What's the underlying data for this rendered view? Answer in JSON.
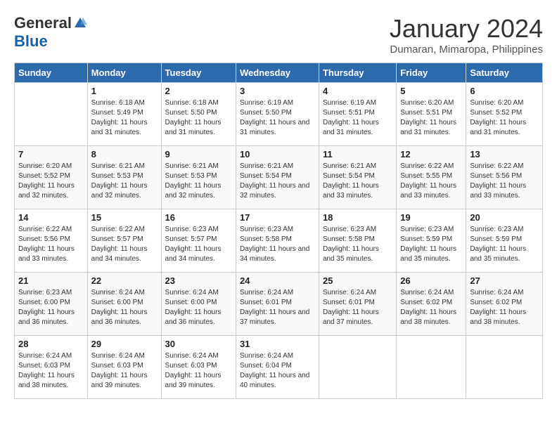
{
  "header": {
    "logo_general": "General",
    "logo_blue": "Blue",
    "month_title": "January 2024",
    "subtitle": "Dumaran, Mimaropa, Philippines"
  },
  "days_of_week": [
    "Sunday",
    "Monday",
    "Tuesday",
    "Wednesday",
    "Thursday",
    "Friday",
    "Saturday"
  ],
  "weeks": [
    [
      {
        "day": "",
        "info": ""
      },
      {
        "day": "1",
        "info": "Sunrise: 6:18 AM\nSunset: 5:49 PM\nDaylight: 11 hours and 31 minutes."
      },
      {
        "day": "2",
        "info": "Sunrise: 6:18 AM\nSunset: 5:50 PM\nDaylight: 11 hours and 31 minutes."
      },
      {
        "day": "3",
        "info": "Sunrise: 6:19 AM\nSunset: 5:50 PM\nDaylight: 11 hours and 31 minutes."
      },
      {
        "day": "4",
        "info": "Sunrise: 6:19 AM\nSunset: 5:51 PM\nDaylight: 11 hours and 31 minutes."
      },
      {
        "day": "5",
        "info": "Sunrise: 6:20 AM\nSunset: 5:51 PM\nDaylight: 11 hours and 31 minutes."
      },
      {
        "day": "6",
        "info": "Sunrise: 6:20 AM\nSunset: 5:52 PM\nDaylight: 11 hours and 31 minutes."
      }
    ],
    [
      {
        "day": "7",
        "info": "Sunrise: 6:20 AM\nSunset: 5:52 PM\nDaylight: 11 hours and 32 minutes."
      },
      {
        "day": "8",
        "info": "Sunrise: 6:21 AM\nSunset: 5:53 PM\nDaylight: 11 hours and 32 minutes."
      },
      {
        "day": "9",
        "info": "Sunrise: 6:21 AM\nSunset: 5:53 PM\nDaylight: 11 hours and 32 minutes."
      },
      {
        "day": "10",
        "info": "Sunrise: 6:21 AM\nSunset: 5:54 PM\nDaylight: 11 hours and 32 minutes."
      },
      {
        "day": "11",
        "info": "Sunrise: 6:21 AM\nSunset: 5:54 PM\nDaylight: 11 hours and 33 minutes."
      },
      {
        "day": "12",
        "info": "Sunrise: 6:22 AM\nSunset: 5:55 PM\nDaylight: 11 hours and 33 minutes."
      },
      {
        "day": "13",
        "info": "Sunrise: 6:22 AM\nSunset: 5:56 PM\nDaylight: 11 hours and 33 minutes."
      }
    ],
    [
      {
        "day": "14",
        "info": "Sunrise: 6:22 AM\nSunset: 5:56 PM\nDaylight: 11 hours and 33 minutes."
      },
      {
        "day": "15",
        "info": "Sunrise: 6:22 AM\nSunset: 5:57 PM\nDaylight: 11 hours and 34 minutes."
      },
      {
        "day": "16",
        "info": "Sunrise: 6:23 AM\nSunset: 5:57 PM\nDaylight: 11 hours and 34 minutes."
      },
      {
        "day": "17",
        "info": "Sunrise: 6:23 AM\nSunset: 5:58 PM\nDaylight: 11 hours and 34 minutes."
      },
      {
        "day": "18",
        "info": "Sunrise: 6:23 AM\nSunset: 5:58 PM\nDaylight: 11 hours and 35 minutes."
      },
      {
        "day": "19",
        "info": "Sunrise: 6:23 AM\nSunset: 5:59 PM\nDaylight: 11 hours and 35 minutes."
      },
      {
        "day": "20",
        "info": "Sunrise: 6:23 AM\nSunset: 5:59 PM\nDaylight: 11 hours and 35 minutes."
      }
    ],
    [
      {
        "day": "21",
        "info": "Sunrise: 6:23 AM\nSunset: 6:00 PM\nDaylight: 11 hours and 36 minutes."
      },
      {
        "day": "22",
        "info": "Sunrise: 6:24 AM\nSunset: 6:00 PM\nDaylight: 11 hours and 36 minutes."
      },
      {
        "day": "23",
        "info": "Sunrise: 6:24 AM\nSunset: 6:00 PM\nDaylight: 11 hours and 36 minutes."
      },
      {
        "day": "24",
        "info": "Sunrise: 6:24 AM\nSunset: 6:01 PM\nDaylight: 11 hours and 37 minutes."
      },
      {
        "day": "25",
        "info": "Sunrise: 6:24 AM\nSunset: 6:01 PM\nDaylight: 11 hours and 37 minutes."
      },
      {
        "day": "26",
        "info": "Sunrise: 6:24 AM\nSunset: 6:02 PM\nDaylight: 11 hours and 38 minutes."
      },
      {
        "day": "27",
        "info": "Sunrise: 6:24 AM\nSunset: 6:02 PM\nDaylight: 11 hours and 38 minutes."
      }
    ],
    [
      {
        "day": "28",
        "info": "Sunrise: 6:24 AM\nSunset: 6:03 PM\nDaylight: 11 hours and 38 minutes."
      },
      {
        "day": "29",
        "info": "Sunrise: 6:24 AM\nSunset: 6:03 PM\nDaylight: 11 hours and 39 minutes."
      },
      {
        "day": "30",
        "info": "Sunrise: 6:24 AM\nSunset: 6:03 PM\nDaylight: 11 hours and 39 minutes."
      },
      {
        "day": "31",
        "info": "Sunrise: 6:24 AM\nSunset: 6:04 PM\nDaylight: 11 hours and 40 minutes."
      },
      {
        "day": "",
        "info": ""
      },
      {
        "day": "",
        "info": ""
      },
      {
        "day": "",
        "info": ""
      }
    ]
  ]
}
